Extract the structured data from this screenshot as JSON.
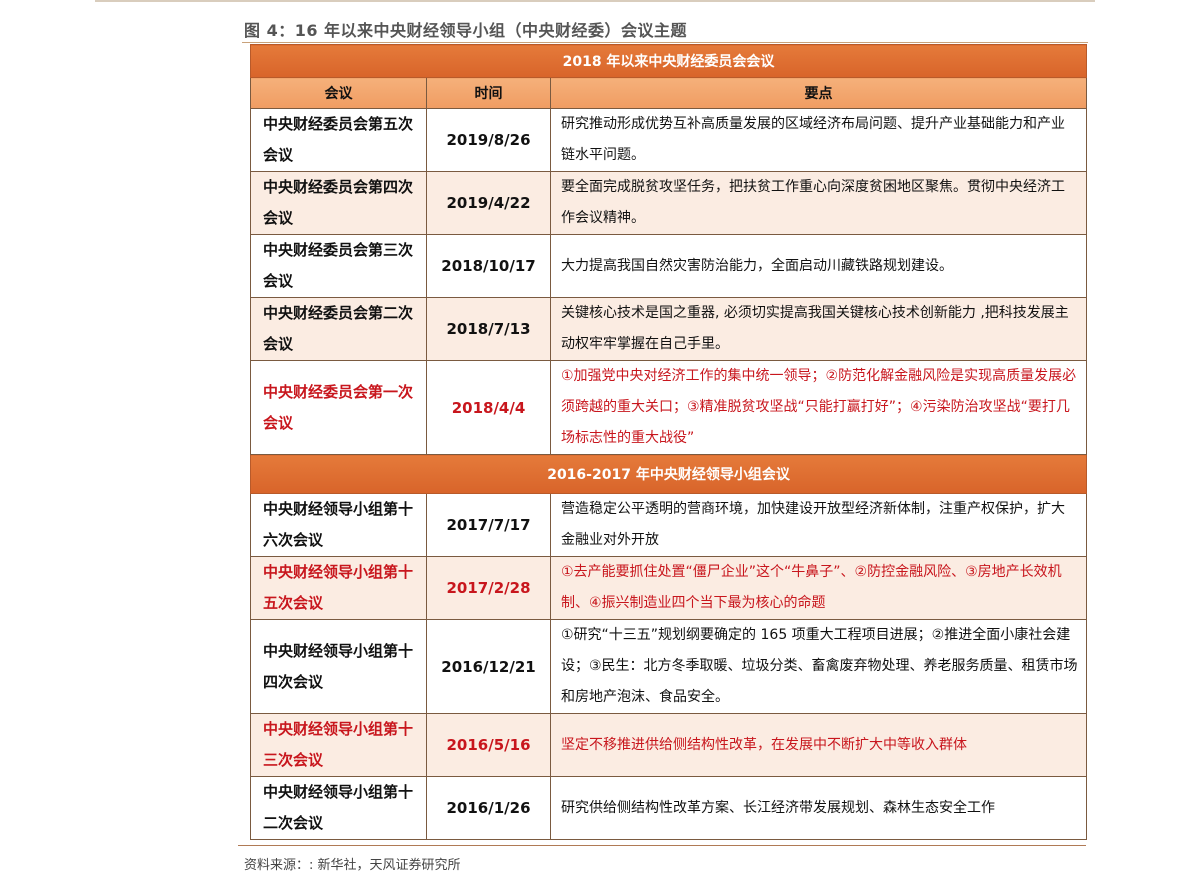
{
  "figure_title": "图 4：16 年以来中央财经领导小组（中央财经委）会议主题",
  "headers": {
    "meeting": "会议",
    "time": "时间",
    "points": "要点"
  },
  "sections": [
    {
      "title": "2018 年以来中央财经委员会会议"
    },
    {
      "title": "2016-2017 年中央财经领导小组会议"
    }
  ],
  "rows": [
    {
      "meeting": "中央财经委员会第五次会议",
      "date": "2019/8/26",
      "points": "研究推动形成优势互补高质量发展的区域经济布局问题、提升产业基础能力和产业链水平问题。"
    },
    {
      "meeting": "中央财经委员会第四次会议",
      "date": "2019/4/22",
      "points": "要全面完成脱贫攻坚任务，把扶贫工作重心向深度贫困地区聚焦。贯彻中央经济工作会议精神。"
    },
    {
      "meeting": "中央财经委员会第三次会议",
      "date": "2018/10/17",
      "points": "大力提高我国自然灾害防治能力，全面启动川藏铁路规划建设。"
    },
    {
      "meeting": "中央财经委员会第二次会议",
      "date": "2018/7/13",
      "points": "关键核心技术是国之重器, 必须切实提高我国关键核心技术创新能力 ,把科技发展主动权牢牢掌握在自己手里。"
    },
    {
      "meeting": "中央财经委员会第一次会议",
      "date": "2018/4/4",
      "points": "①加强党中央对经济工作的集中统一领导；②防范化解金融风险是实现高质量发展必须跨越的重大关口；③精准脱贫攻坚战“只能打赢打好”；④污染防治攻坚战“要打几场标志性的重大战役”"
    },
    {
      "meeting": "中央财经领导小组第十六次会议",
      "date": "2017/7/17",
      "points": "营造稳定公平透明的营商环境，加快建设开放型经济新体制，注重产权保护，扩大金融业对外开放"
    },
    {
      "meeting": "中央财经领导小组第十五次会议",
      "date": "2017/2/28",
      "points": "①去产能要抓住处置“僵尸企业”这个“牛鼻子”、②防控金融风险、③房地产长效机制、④振兴制造业四个当下最为核心的命题"
    },
    {
      "meeting": "中央财经领导小组第十四次会议",
      "date": "2016/12/21",
      "points": "①研究“十三五”规划纲要确定的 165 项重大工程项目进展；②推进全面小康社会建设；③民生：北方冬季取暖、垃圾分类、畜禽废弃物处理、养老服务质量、租赁市场和房地产泡沫、食品安全。"
    },
    {
      "meeting": "中央财经领导小组第十三次会议",
      "date": "2016/5/16",
      "points": "坚定不移推进供给侧结构性改革，在发展中不断扩大中等收入群体"
    },
    {
      "meeting": "中央财经领导小组第十二次会议",
      "date": "2016/1/26",
      "points": "研究供给侧结构性改革方案、长江经济带发展规划、森林生态安全工作"
    }
  ],
  "source": "资料来源：: 新华社，天风证券研究所"
}
